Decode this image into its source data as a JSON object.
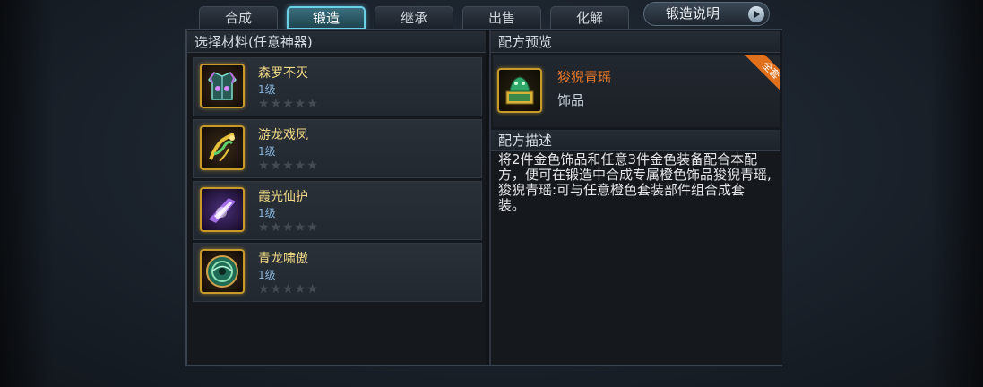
{
  "tabs": [
    {
      "label": "合成"
    },
    {
      "label": "锻造"
    },
    {
      "label": "继承"
    },
    {
      "label": "出售"
    },
    {
      "label": "化解"
    }
  ],
  "active_tab": "锻造",
  "help_button": {
    "label": "锻造说明",
    "icon": "arrow-right-icon"
  },
  "materials": {
    "header": "选择材料(任意神器)",
    "items": [
      {
        "name": "森罗不灭",
        "level": "1级",
        "stars": "★★★★★",
        "icon": "armor-icon"
      },
      {
        "name": "游龙戏凤",
        "level": "1级",
        "stars": "★★★★★",
        "icon": "dragon-weapon-icon"
      },
      {
        "name": "霞光仙护",
        "level": "1级",
        "stars": "★★★★★",
        "icon": "crystal-icon"
      },
      {
        "name": "青龙啸傲",
        "level": "1级",
        "stars": "★★★★★",
        "icon": "jade-disc-icon"
      }
    ]
  },
  "recipe_preview": {
    "header": "配方预览",
    "item_name": "狻猊青瑶",
    "item_type": "饰品",
    "badge": "全套",
    "icon": "jade-seal-icon"
  },
  "recipe_description": {
    "header": "配方描述",
    "text": "将2件金色饰品和任意3件金色装备配合本配方，便可在锻造中合成专属橙色饰品狻猊青瑶,狻猊青瑶:可与任意橙色套装部件组合成套装。"
  },
  "colors": {
    "item_name_gold": "#f1d985",
    "preview_name_orange": "#ef7a2a",
    "level_blue": "#86b4dc",
    "badge_orange": "#e0701c",
    "active_tab_border": "#6ad0e8"
  }
}
